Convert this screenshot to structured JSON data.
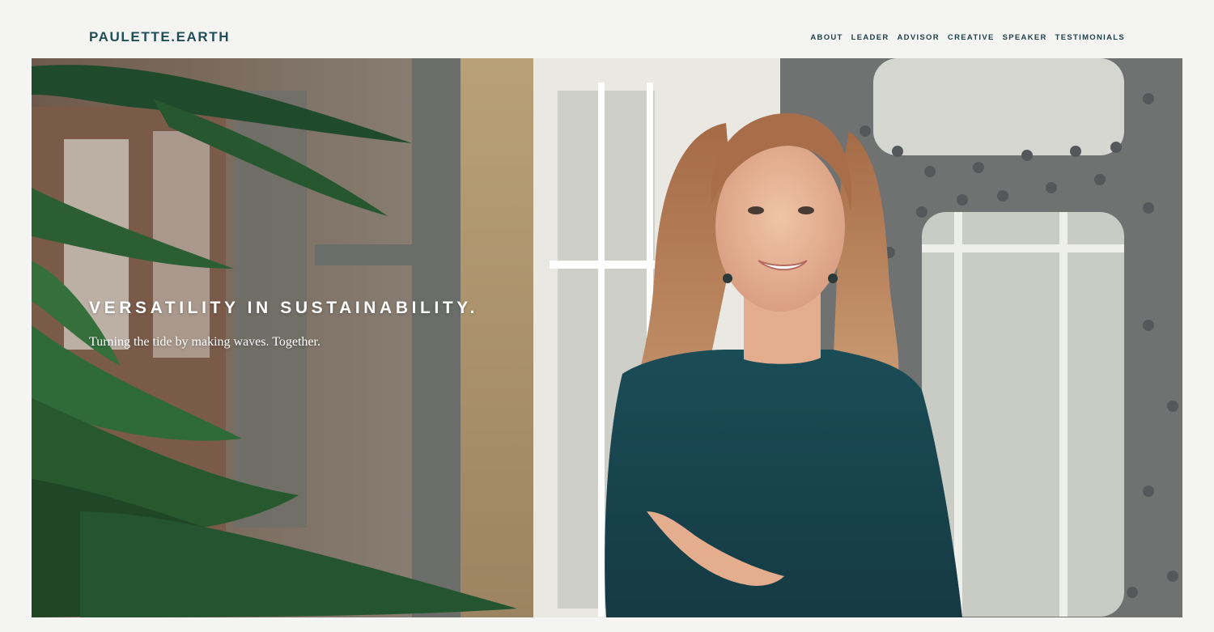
{
  "site": {
    "logo": "PAULETTE.EARTH"
  },
  "nav": {
    "items": [
      "ABOUT",
      "LEADER",
      "ADVISOR",
      "CREATIVE",
      "SPEAKER",
      "TESTIMONIALS"
    ]
  },
  "hero": {
    "title": "VERSATILITY IN SUSTAINABILITY.",
    "subtitle": "Turning the tide by making waves. Together.",
    "image": "portrait-photo"
  },
  "colors": {
    "brand": "#1f4e57",
    "page_bg": "#f4f4f3",
    "hero_text": "#ffffff"
  }
}
